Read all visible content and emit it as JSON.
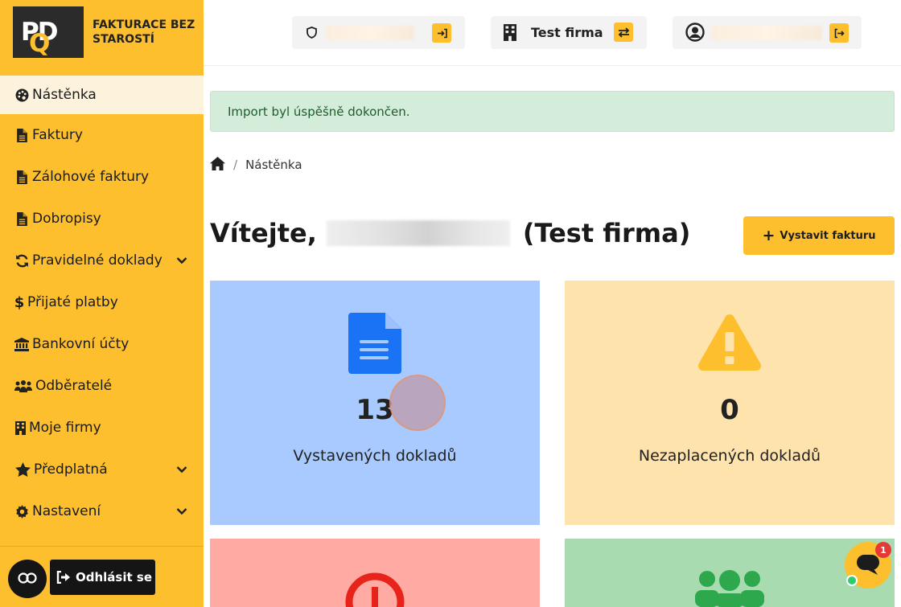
{
  "brand": {
    "logo_text": "PDQ",
    "tagline": "FAKTURACE BEZ STAROSTÍ"
  },
  "sidebar": {
    "items": [
      {
        "label": "Nástěnka",
        "icon": "palette-icon",
        "active": true
      },
      {
        "label": "Faktury",
        "icon": "file-icon"
      },
      {
        "label": "Zálohové faktury",
        "icon": "file-icon"
      },
      {
        "label": "Dobropisy",
        "icon": "file-icon"
      },
      {
        "label": "Pravidelné doklady",
        "icon": "sync-icon",
        "has_submenu": true
      },
      {
        "label": "Přijaté platby",
        "icon": "dollar-icon"
      },
      {
        "label": "Bankovní účty",
        "icon": "bank-icon"
      },
      {
        "label": "Odběratelé",
        "icon": "users-icon"
      },
      {
        "label": "Moje firmy",
        "icon": "building-icon"
      },
      {
        "label": "Předplatná",
        "icon": "star-icon",
        "has_submenu": true
      },
      {
        "label": "Nastavení",
        "icon": "cog-icon",
        "has_submenu": true
      }
    ],
    "logout_label": "Odhlásit se"
  },
  "header": {
    "company": "Test firma"
  },
  "alert": {
    "text": "Import byl úspěšně dokončen."
  },
  "breadcrumb": {
    "current": "Nástěnka"
  },
  "welcome": {
    "prefix": "Vítejte,",
    "suffix": "(Test firma)"
  },
  "actions": {
    "new_invoice": "Vystavit fakturu"
  },
  "stats": [
    {
      "value": "13",
      "label": "Vystavených dokladů",
      "color": "#a9caff",
      "icon": "document-icon"
    },
    {
      "value": "0",
      "label": "Nezaplacených dokladů",
      "color": "#ffe3ad",
      "icon": "warning-icon"
    }
  ],
  "chat": {
    "badge": "1"
  },
  "colors": {
    "accent": "#fdbf2d",
    "success_bg": "#d4edda",
    "card_blue": "#a9caff",
    "card_yellow": "#ffe3ad",
    "card_red": "#ffaba3",
    "card_green": "#a8dbb0"
  }
}
